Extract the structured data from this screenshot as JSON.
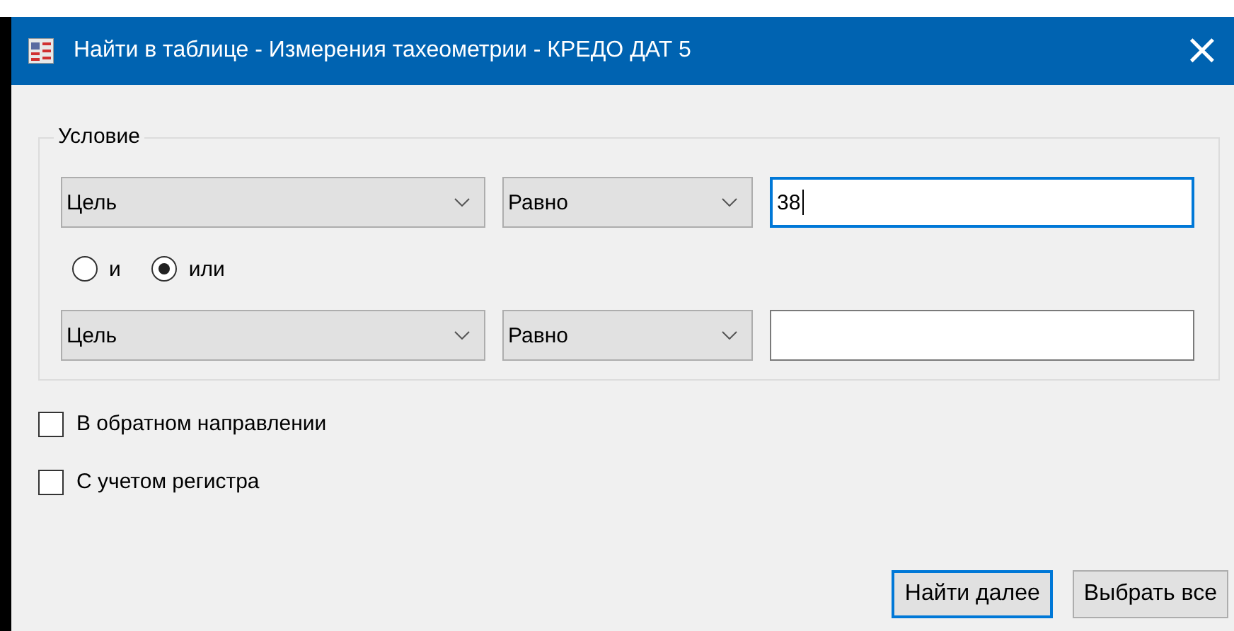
{
  "window": {
    "title": "Найти в таблице - Измерения тахеометрии - КРЕДО ДАТ 5",
    "close": "×"
  },
  "condition": {
    "title": "Условие",
    "rows": [
      {
        "field": "Цель",
        "operator": "Равно",
        "value": "38",
        "focused": true
      },
      {
        "field": "Цель",
        "operator": "Равно",
        "value": "",
        "focused": false
      }
    ],
    "logic": [
      {
        "label": "и",
        "selected": false
      },
      {
        "label": "или",
        "selected": true
      }
    ]
  },
  "options": [
    {
      "label": "В обратном направлении",
      "checked": false
    },
    {
      "label": "С учетом регистра",
      "checked": false
    }
  ],
  "buttons": [
    {
      "label": "Найти далее",
      "default": true
    },
    {
      "label": "Выбрать все",
      "default": false
    }
  ]
}
